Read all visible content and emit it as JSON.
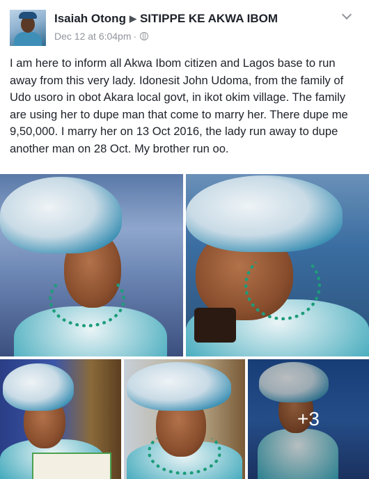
{
  "post": {
    "author": "Isaiah Otong",
    "group": "SITIPPE KE AKWA IBOM",
    "timestamp": "Dec 12 at 6:04pm",
    "privacy_icon": "globe-icon",
    "text": "I am here to inform all Akwa Ibom citizen and Lagos base to run away from this very lady. Idonesit John Udoma, from the family of Udo usoro in obot Akara local govt, in ikot okim village. The family are using her to dupe man that come to marry her. There dupe me 9,50,000. I marry her on 13 Oct 2016, the lady run away to dupe another man on 28 Oct. My brother run oo."
  },
  "photos": {
    "more_count": "+3"
  },
  "colors": {
    "name": "#1d2129",
    "meta": "#90949c"
  }
}
